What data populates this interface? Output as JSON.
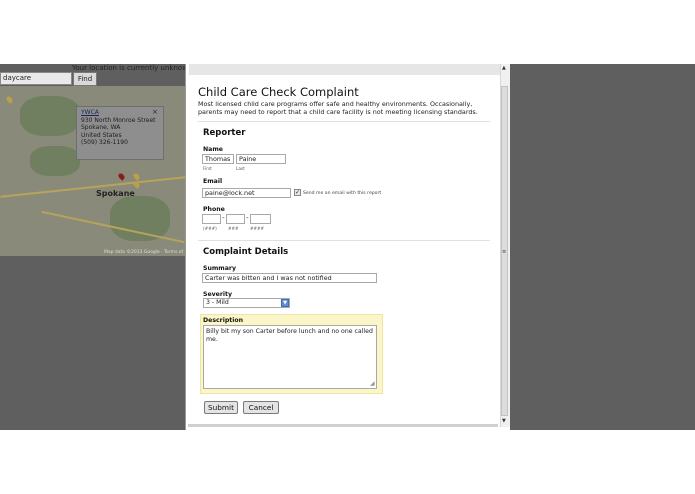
{
  "background_page": {
    "location_status": "Your location is currently unknown",
    "search_value": "daycare",
    "find_label": "Find",
    "info_window": {
      "name": "YWCA",
      "street": "930 North Monroe Street",
      "city": "Spokane, WA",
      "country": "United States",
      "phone": "(509) 326-1190"
    },
    "close_glyph": "×",
    "city_label": "Spokane",
    "map_credit": "Map data ©2013 Google · Terms of"
  },
  "dialog": {
    "title": "Child Care Check Complaint",
    "intro": "Most licensed child care programs offer safe and healthy environments. Occasionally, parents may need to report that a child care facility is not meeting licensing standards.",
    "reporter": {
      "heading": "Reporter",
      "name_label": "Name",
      "first_value": "Thomas",
      "last_value": "Paine",
      "first_sub": "First",
      "last_sub": "Last",
      "email_label": "Email",
      "email_value": "paine@lock.net",
      "email_checked": true,
      "send_email_note": "Send me an email with this report",
      "phone_label": "Phone",
      "phone_sub_area": "(###)",
      "phone_sub_prefix": "###",
      "phone_sub_line": "####",
      "phone_sep": "-"
    },
    "complaint": {
      "heading": "Complaint Details",
      "summary_label": "Summary",
      "summary_value": "Carter was bitten and I was not notified",
      "severity_label": "Severity",
      "severity_value": "3 - Mild",
      "description_label": "Description",
      "description_value": "Billy bit my son Carter before lunch and no one called me."
    },
    "submit_label": "Submit",
    "cancel_label": "Cancel"
  },
  "icons": {
    "check": "✓",
    "dropdown": "▼",
    "scroll_up": "▲",
    "scroll_down": "▼",
    "resize": "◢",
    "scroll_grip": "≡"
  },
  "colors": {
    "overlay": "#5f5f5f",
    "highlight": "#fbf6c8",
    "select_arrow": "#5a8fd6"
  }
}
